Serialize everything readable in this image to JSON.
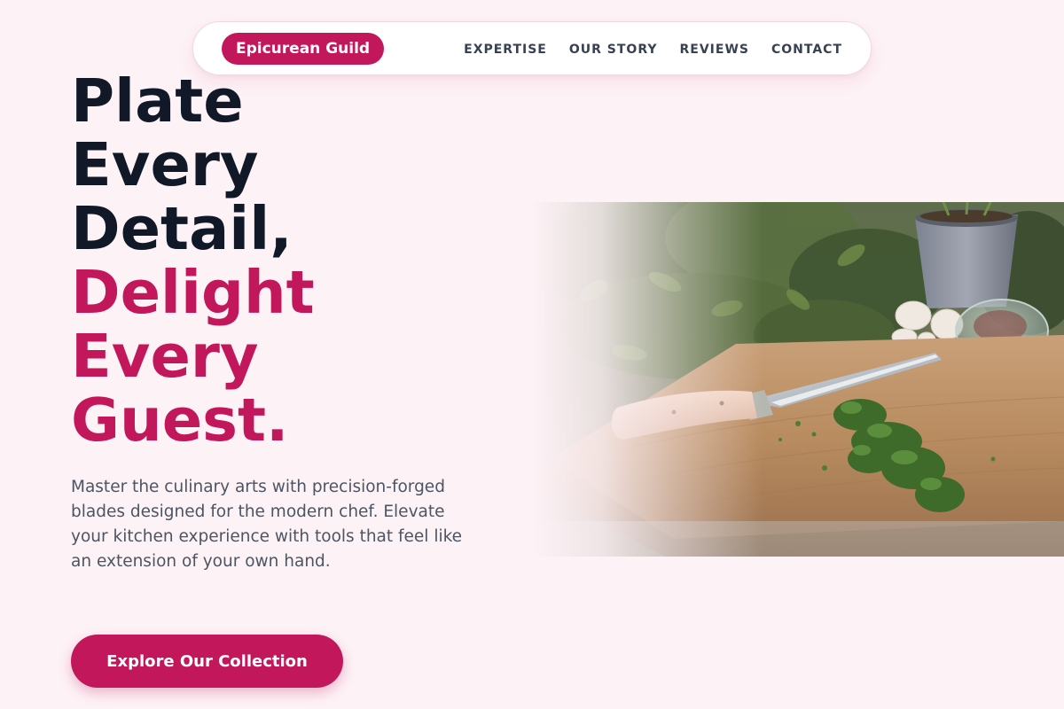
{
  "nav": {
    "brand": "Epicurean Guild",
    "links": [
      "EXPERTISE",
      "OUR STORY",
      "REVIEWS",
      "CONTACT"
    ]
  },
  "hero": {
    "title_lines": [
      "Plate",
      "Every",
      "Detail,"
    ],
    "title_accent_lines": [
      "Delight",
      "Every",
      "Guest."
    ],
    "description": "Master the culinary arts with precision-forged blades designed for the modern chef. Elevate your kitchen experience with tools that feel like an extension of your own hand.",
    "cta_label": "Explore Our Collection"
  },
  "colors": {
    "accent": "#c2185b",
    "background": "#fdf2f6",
    "heading": "#111827",
    "body_text": "#4b5563",
    "nav_text": "#374151"
  },
  "image": {
    "subject": "chef-knife-on-cutting-board-with-herbs"
  }
}
